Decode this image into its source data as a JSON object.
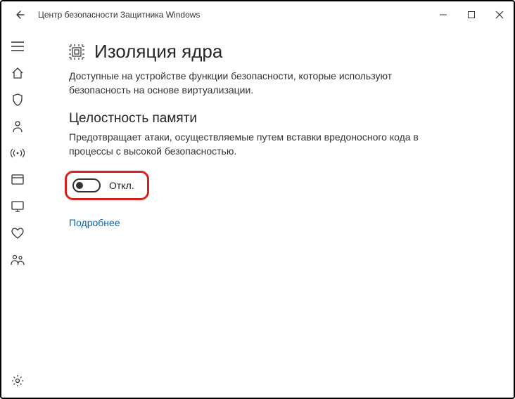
{
  "window": {
    "title": "Центр безопасности Защитника Windows"
  },
  "page": {
    "heading": "Изоляция ядра",
    "description": "Доступные на устройстве функции безопасности, которые используют безопасность на основе виртуализации."
  },
  "section": {
    "heading": "Целостность памяти",
    "description": "Предотвращает атаки, осуществляемые путем вставки вредоносного кода в процессы с высокой безопасностью.",
    "toggle_state": "Откл.",
    "more_link": "Подробнее"
  },
  "colors": {
    "highlight_border": "#d8201e",
    "link": "#0066b4"
  }
}
